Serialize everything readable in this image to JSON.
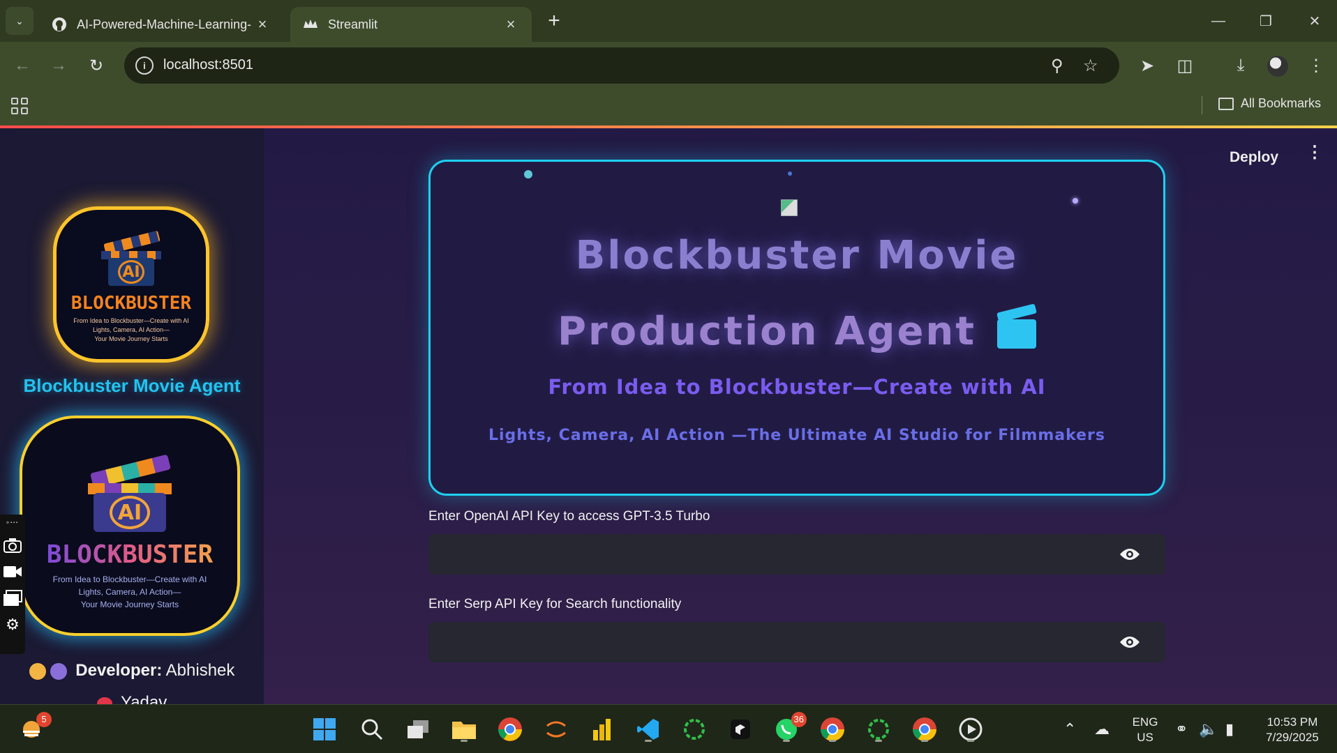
{
  "browser": {
    "tabs": [
      {
        "title": "AI-Powered-Machine-Learning-",
        "active": false,
        "favicon": "github-icon"
      },
      {
        "title": "Streamlit",
        "active": true,
        "favicon": "streamlit-crown-icon"
      }
    ],
    "url": "localhost:8501",
    "bookmarks_label": "All Bookmarks",
    "accent_color": "#3e4c2c"
  },
  "app": {
    "deploy_label": "Deploy",
    "menu_icon": "kebab-menu-icon"
  },
  "sidebar": {
    "logo_small": {
      "wordmark": "BLOCKBUSTER",
      "tagline_1": "From Idea to Blockbuster—Create with AI",
      "tagline_2": "Lights, Camera, AI Action—",
      "tagline_3": "Your Movie Journey Starts",
      "badge": "AI"
    },
    "title": "Blockbuster Movie Agent",
    "logo_big": {
      "wordmark": "BLOCKBUSTER",
      "tagline_1": "From Idea to Blockbuster—Create with AI",
      "tagline_2": "Lights, Camera, AI Action—",
      "tagline_3": "Your Movie Journey Starts",
      "badge": "AI"
    },
    "developer_label": "Developer:",
    "developer_name": "Abhishek",
    "developer_name_2": "Yadav"
  },
  "hero": {
    "title_line_1": "Blockbuster Movie",
    "title_line_2": "Production Agent",
    "subtitle": "From Idea to Blockbuster—Create with AI",
    "tagline": "Lights, Camera, AI Action —The Ultimate AI Studio for Filmmakers",
    "border_color": "#1ed0f0"
  },
  "form": {
    "openai_label": "Enter OpenAI API Key to access GPT-3.5 Turbo",
    "openai_value": "",
    "serp_label": "Enter Serp API Key for Search functionality",
    "serp_value": ""
  },
  "taskbar": {
    "notification_badge": "5",
    "whatsapp_badge": "36",
    "language_line_1": "ENG",
    "language_line_2": "US",
    "time": "10:53 PM",
    "date": "7/29/2025"
  }
}
